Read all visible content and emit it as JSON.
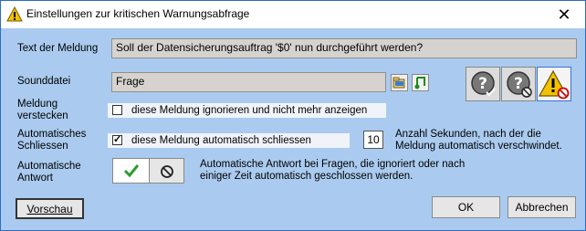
{
  "window": {
    "title": "Einstellungen zur kritischen Warnungsabfrage",
    "close_glyph": "✕"
  },
  "message": {
    "label": "Text der Meldung",
    "value": "Soll der Datensicherungsauftrag '$0' nun durchgeführt werden?"
  },
  "sound": {
    "label": "Sounddatei",
    "value": "Frage"
  },
  "hide": {
    "label_line1": "Meldung",
    "label_line2": "verstecken",
    "checkbox_label": "diese Meldung ignorieren und nicht mehr anzeigen",
    "checked": false
  },
  "autoclose": {
    "label_line1": "Automatisches",
    "label_line2": "Schliessen",
    "checkbox_label": "diese Meldung automatisch schliessen",
    "checked": true,
    "seconds": "10",
    "seconds_desc": "Anzahl Sekunden, nach der die Meldung automatisch verschwindet."
  },
  "autoanswer": {
    "label_line1": "Automatische",
    "label_line2": "Antwort",
    "desc": "Automatische Antwort bei Fragen, die ignoriert oder nach einiger Zeit automatisch geschlossen werden."
  },
  "buttons": {
    "preview": "Vorschau",
    "ok": "OK",
    "cancel": "Abbrechen"
  },
  "icons": {
    "warning": "warning-icon",
    "question": "question-icon",
    "question_forbidden": "question-forbidden-icon",
    "warning_forbidden": "warning-forbidden-icon",
    "browse": "browse-icon",
    "play_sound": "play-sound-icon",
    "check": "check-icon",
    "forbidden": "forbidden-icon"
  },
  "colors": {
    "dialog_bg": "#aacbef",
    "title_bg": "#ffffff",
    "field_bg": "#d6d3ce",
    "check_green": "#2e9d2e"
  }
}
